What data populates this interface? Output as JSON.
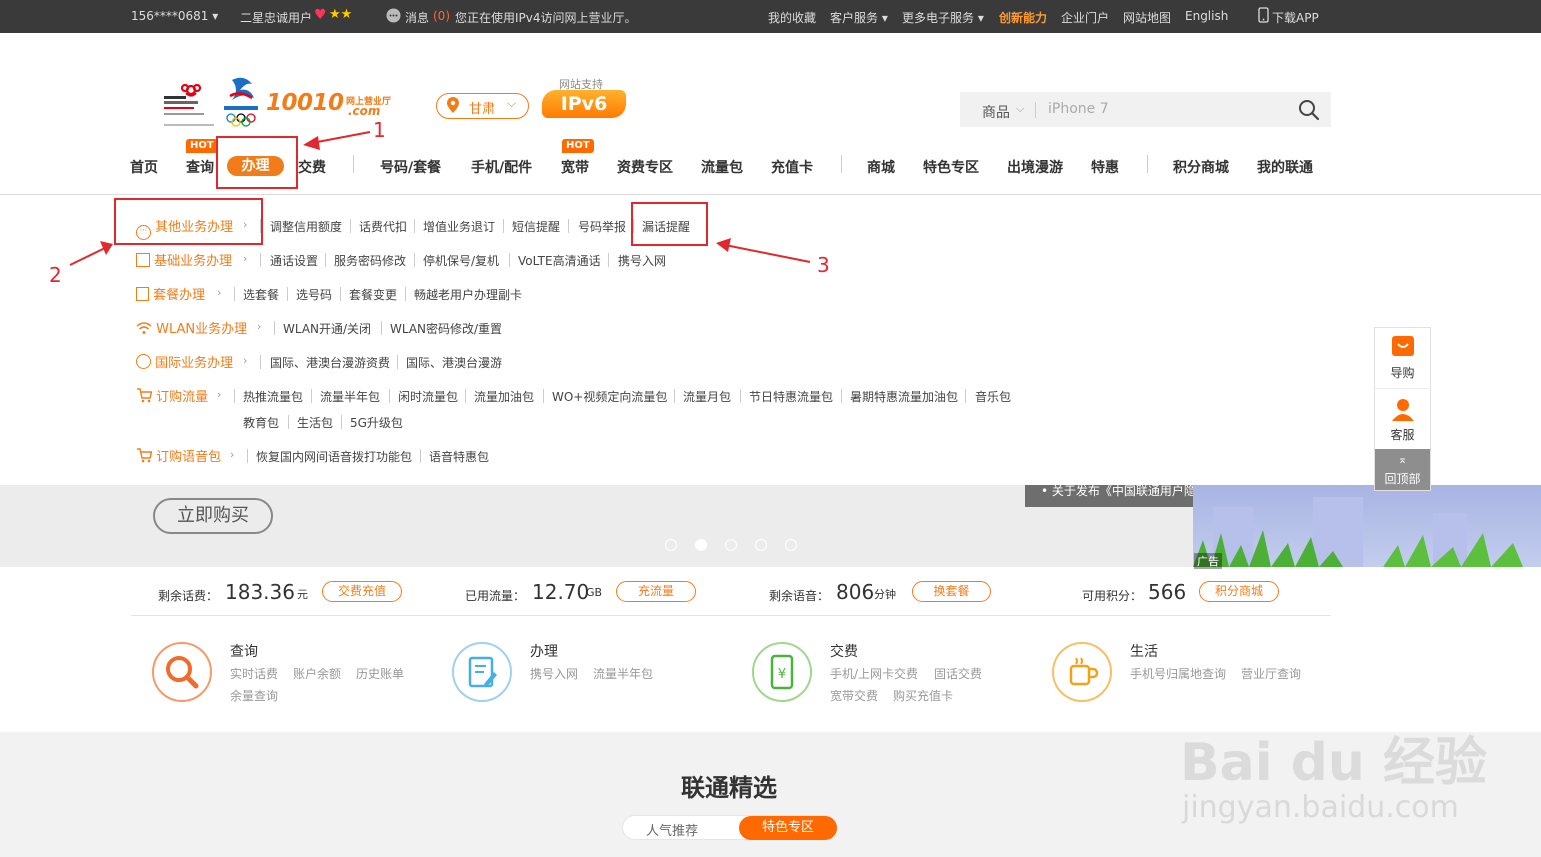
{
  "topbar": {
    "user": "156****0681 ▾",
    "level": "二星忠诚用户",
    "msg_label": "消息",
    "msg_count": "(0)",
    "msg_text": "您正在使用IPv4访问网上营业厅。",
    "favorites": "我的收藏",
    "customer_service": "客户服务 ▾",
    "more_services": "更多电子服务 ▾",
    "innovation": "创新能力",
    "enterprise": "企业门户",
    "sitemap": "网站地图",
    "english": "English",
    "download_app": "下载APP"
  },
  "header": {
    "logo_text": "10010",
    "logo_sub": "网上营业厅",
    "logo_com": ".com",
    "province": "甘肃",
    "ipv6_label": "网站支持",
    "ipv6": "IPv6",
    "search_category": "商品",
    "search_placeholder": "iPhone 7"
  },
  "nav": {
    "home": "首页",
    "query": "查询",
    "handle": "办理",
    "pay": "交费",
    "number": "号码/套餐",
    "phone": "手机/配件",
    "broadband": "宽带",
    "tariff": "资费专区",
    "traffic": "流量包",
    "recharge": "充值卡",
    "mall": "商城",
    "special": "特色专区",
    "roaming": "出境漫游",
    "deals": "特惠",
    "points": "积分商城",
    "my": "我的联通",
    "hot": "HOT"
  },
  "dropdown": {
    "r1": {
      "cat": "其他业务办理",
      "links": [
        "调整信用额度",
        "话费代扣",
        "增值业务退订",
        "短信提醒",
        "号码举报",
        "漏话提醒"
      ]
    },
    "r2": {
      "cat": "基础业务办理",
      "links": [
        "通话设置",
        "服务密码修改",
        "停机保号/复机",
        "VoLTE高清通话",
        "携号入网"
      ]
    },
    "r3": {
      "cat": "套餐办理",
      "links": [
        "选套餐",
        "选号码",
        "套餐变更",
        "畅越老用户办理副卡"
      ]
    },
    "r4": {
      "cat": "WLAN业务办理",
      "links": [
        "WLAN开通/关闭",
        "WLAN密码修改/重置"
      ]
    },
    "r5": {
      "cat": "国际业务办理",
      "links": [
        "国际、港澳台漫游资费",
        "国际、港澳台漫游"
      ]
    },
    "r6": {
      "cat": "订购流量",
      "links": [
        "热推流量包",
        "流量半年包",
        "闲时流量包",
        "流量加油包",
        "WO+视频定向流量包",
        "流量月包",
        "节日特惠流量包",
        "暑期特惠流量加油包",
        "音乐包",
        "教育包",
        "生活包",
        "5G升级包"
      ]
    },
    "r7": {
      "cat": "订购语音包",
      "links": [
        "恢复国内网间语音拨打功能包",
        "语音特惠包"
      ]
    }
  },
  "banner": {
    "buy_now": "立即购买",
    "notice": "• 关于发布《中国联通用户隐私政策》及完善相...",
    "ad": "广告"
  },
  "stats": {
    "balance_label": "剩余话费：",
    "balance": "183.36",
    "balance_unit": "元",
    "balance_btn": "交费充值",
    "traffic_label": "已用流量：",
    "traffic": "12.70",
    "traffic_unit": "GB",
    "traffic_btn": "充流量",
    "voice_label": "剩余语音：",
    "voice": "806",
    "voice_unit": "分钟",
    "voice_btn": "换套餐",
    "points_label": "可用积分：",
    "points": "566",
    "points_btn": "积分商城"
  },
  "quick": {
    "query": {
      "title": "查询",
      "links": [
        "实时话费",
        "账户余额",
        "历史账单",
        "余量查询"
      ]
    },
    "handle": {
      "title": "办理",
      "links": [
        "携号入网",
        "流量半年包"
      ]
    },
    "pay": {
      "title": "交费",
      "links": [
        "手机/上网卡交费",
        "固话交费",
        "宽带交费",
        "购买充值卡"
      ]
    },
    "life": {
      "title": "生活",
      "links": [
        "手机号归属地查询",
        "营业厅查询"
      ]
    }
  },
  "section": {
    "title": "联通精选",
    "tab1": "人气推荐",
    "tab2": "特色专区"
  },
  "side": {
    "guide": "导购",
    "service": "客服",
    "top": "回顶部"
  },
  "annotations": {
    "a1": "1",
    "a2": "2",
    "a3": "3"
  },
  "watermark": {
    "main": "Bai du 经验",
    "sub": "jingyan.baidu.com"
  }
}
